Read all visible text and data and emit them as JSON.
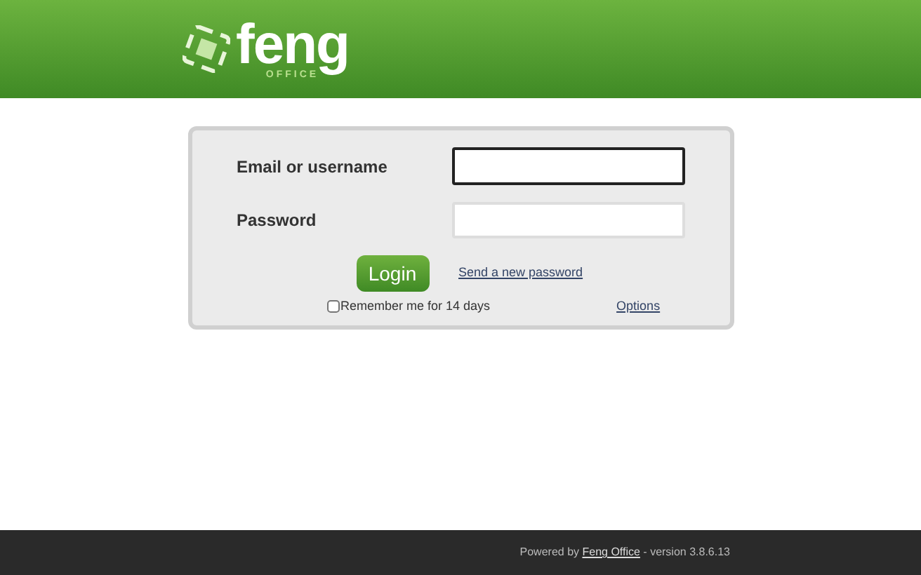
{
  "header": {
    "logo": {
      "name": "feng",
      "subtitle": "OFFICE"
    }
  },
  "login_form": {
    "fields": [
      {
        "label": "Email or username",
        "focused": true
      },
      {
        "label": "Password",
        "focused": false
      }
    ],
    "login_button": "Login",
    "send_password_link": "Send a new password",
    "remember": {
      "label": "Remember me for 14 days",
      "checked": false
    },
    "options_link": "Options"
  },
  "footer": {
    "prefix": "Powered by",
    "link": "Feng Office",
    "suffix": "- version 3.8.6.13"
  }
}
